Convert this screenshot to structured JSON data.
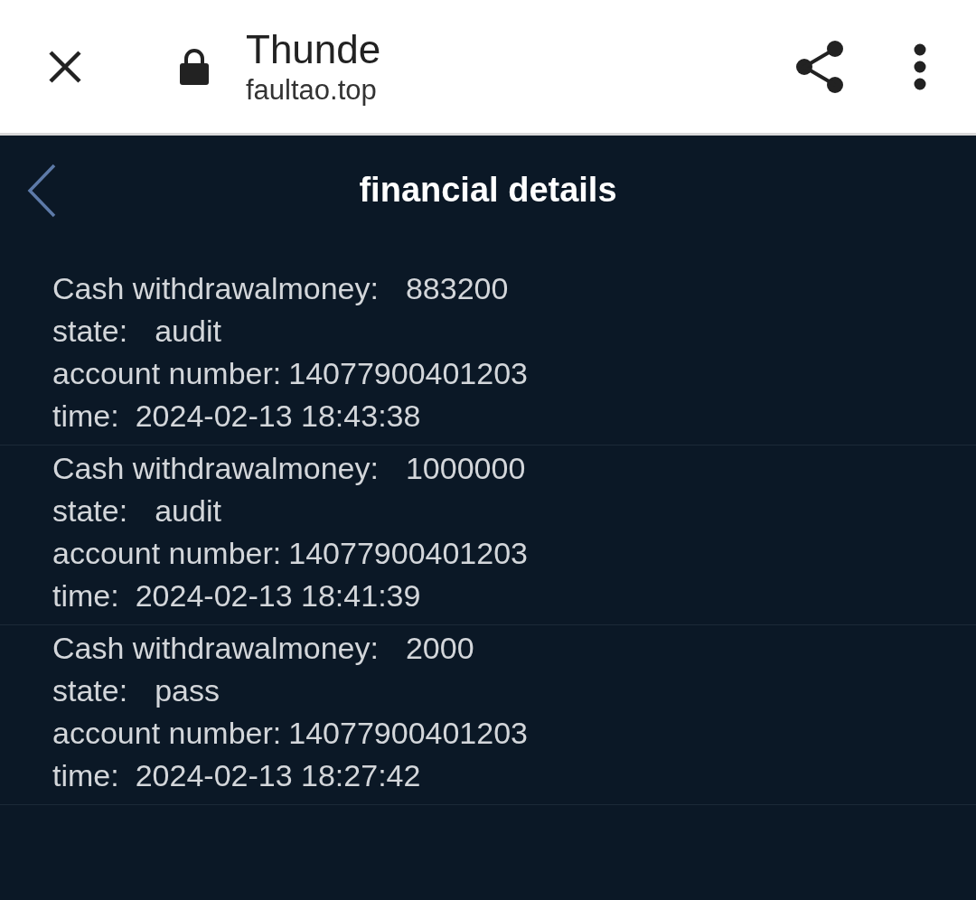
{
  "browser_bar": {
    "title": "Thunde",
    "url": "faultao.top"
  },
  "header": {
    "title": "financial details"
  },
  "records": [
    {
      "fields": [
        {
          "label": "Cash withdrawalmoney:",
          "value": "883200"
        },
        {
          "label": "state:",
          "value": "audit"
        },
        {
          "label": "account number:",
          "value": "14077900401203"
        },
        {
          "label": "time:",
          "value": "2024-02-13 18:43:38"
        }
      ]
    },
    {
      "fields": [
        {
          "label": "Cash withdrawalmoney:",
          "value": "1000000"
        },
        {
          "label": "state:",
          "value": "audit"
        },
        {
          "label": "account number:",
          "value": "14077900401203"
        },
        {
          "label": "time:",
          "value": "2024-02-13 18:41:39"
        }
      ]
    },
    {
      "fields": [
        {
          "label": "Cash withdrawalmoney:",
          "value": "2000"
        },
        {
          "label": "state:",
          "value": "pass"
        },
        {
          "label": "account number:",
          "value": "14077900401203"
        },
        {
          "label": "time:",
          "value": "2024-02-13 18:27:42"
        }
      ]
    }
  ]
}
